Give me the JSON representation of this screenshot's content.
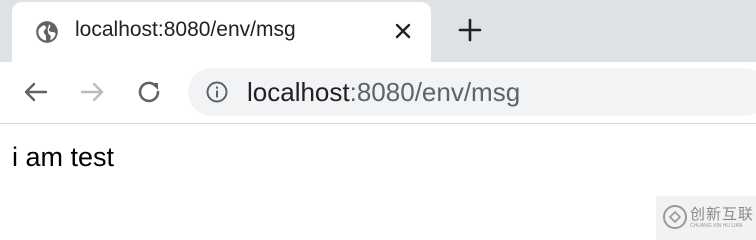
{
  "tab": {
    "title": "localhost:8080/env/msg",
    "favicon": "globe-icon",
    "close_icon": "close-icon"
  },
  "new_tab_icon": "plus-icon",
  "toolbar": {
    "back_icon": "arrow-left-icon",
    "forward_icon": "arrow-right-icon",
    "reload_icon": "reload-icon",
    "info_icon": "info-icon",
    "url_host": "localhost",
    "url_rest": ":8080/env/msg"
  },
  "page": {
    "body_text": "i am test"
  },
  "watermark": {
    "text": "创新互联",
    "sub": "CHUANG XIN HU LIAN"
  },
  "colors": {
    "tabstrip_bg": "#dee1e6",
    "omnibox_bg": "#f1f3f4",
    "text": "#202124",
    "muted": "#5f6368"
  }
}
